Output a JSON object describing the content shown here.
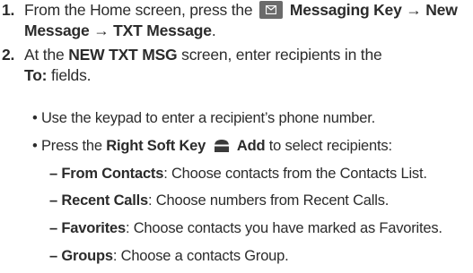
{
  "steps": [
    {
      "number": "1.",
      "text_before": "From the Home screen, press the",
      "icon": "messaging-key-icon",
      "bold_path": "Messaging Key → New",
      "bold_path_2": "Message → TXT Message",
      "end": "."
    },
    {
      "number": "2.",
      "text_1": "At the",
      "bold_1": "NEW TXT MSG",
      "text_2": "screen, enter recipients in the",
      "bold_2": "To:",
      "text_3": "fields."
    }
  ],
  "bullets": [
    {
      "marker": "•",
      "text": "Use the keypad to enter a recipient’s phone number."
    },
    {
      "marker": "•",
      "text_1": "Press the",
      "bold_1": "Right Soft Key",
      "icon": "right-soft-key-icon",
      "bold_2": "Add",
      "text_2": "to select recipients:"
    }
  ],
  "dash_items": [
    {
      "marker": "–",
      "label": "From Contacts",
      "text": ": Choose contacts from the Contacts List."
    },
    {
      "marker": "–",
      "label": "Recent Calls",
      "text": ": Choose numbers from Recent Calls."
    },
    {
      "marker": "–",
      "label": "Favorites",
      "text": ": Choose contacts you have marked as Favorites."
    },
    {
      "marker": "–",
      "label": "Groups",
      "text": ": Choose a contacts Group."
    }
  ],
  "colors": {
    "text": "#2b2b2b",
    "key_icon_bg": "#6b6b6b"
  }
}
